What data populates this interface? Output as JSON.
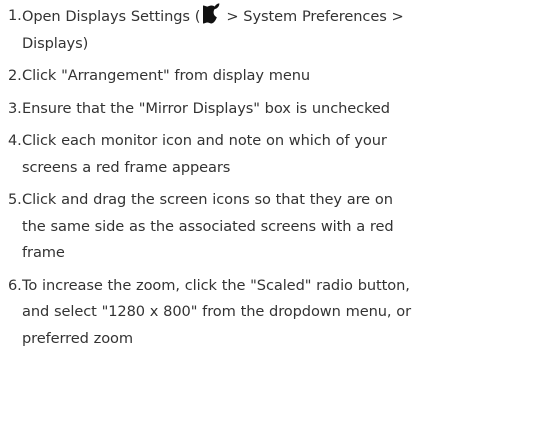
{
  "steps": [
    {
      "number": "1.",
      "line1_before": "Open Displays Settings (",
      "icon": "apple-icon",
      "line1_after": "> System Preferences >",
      "line2": "Displays)"
    },
    {
      "number": "2.",
      "line1": "Click \"Arrangement\" from display menu"
    },
    {
      "number": "3.",
      "line1": "Ensure that the \"Mirror Displays\" box is unchecked"
    },
    {
      "number": "4.",
      "line1": "Click each monitor icon and note on which of your",
      "line2": "screens a red frame appears"
    },
    {
      "number": "5.",
      "line1": "Click and drag the screen icons so that they are on",
      "line2": "the same side as the associated screens with a red",
      "line3": "frame"
    },
    {
      "number": "6.",
      "line1": "To increase the zoom, click the \"Scaled\" radio button,",
      "line2": "and select \"1280 x 800\" from the dropdown menu, or",
      "line3": "preferred zoom"
    }
  ],
  "colors": {
    "text": "#333333",
    "background": "#ffffff"
  }
}
